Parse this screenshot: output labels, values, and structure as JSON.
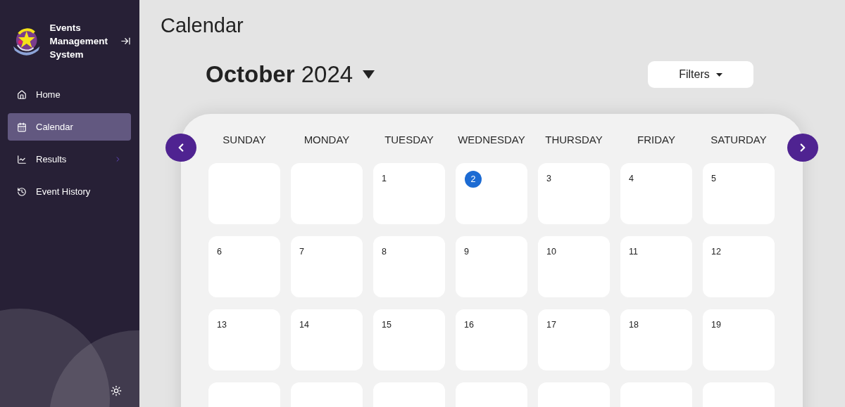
{
  "sidebar": {
    "app_name": "Events Management System",
    "items": [
      {
        "label": "Home",
        "selected": false,
        "has_submenu": false
      },
      {
        "label": "Calendar",
        "selected": true,
        "has_submenu": false
      },
      {
        "label": "Results",
        "selected": false,
        "has_submenu": true
      },
      {
        "label": "Event History",
        "selected": false,
        "has_submenu": false
      }
    ]
  },
  "page_title": "Calendar",
  "month_picker": {
    "label": "**October** 2024"
  },
  "filters_button": {
    "label": "Filters"
  },
  "calendar": {
    "weekdays": [
      "SUNDAY",
      "MONDAY",
      "TUESDAY",
      "WEDNESDAY",
      "THURSDAY",
      "FRIDAY",
      "SATURDAY"
    ],
    "weeks": [
      [
        {
          "kind": "blank"
        },
        {
          "kind": "blank"
        },
        {
          "day": "1",
          "today": false
        },
        {
          "day": "2",
          "today": true
        },
        {
          "day": "3",
          "today": false
        },
        {
          "day": "4",
          "today": false
        },
        {
          "day": "5",
          "today": false
        }
      ],
      [
        {
          "day": "6",
          "today": false
        },
        {
          "day": "7",
          "today": false
        },
        {
          "day": "8",
          "today": false
        },
        {
          "day": "9",
          "today": false
        },
        {
          "day": "10",
          "today": false
        },
        {
          "day": "11",
          "today": false
        },
        {
          "day": "12",
          "today": false
        }
      ],
      [
        {
          "day": "13",
          "today": false
        },
        {
          "day": "14",
          "today": false
        },
        {
          "day": "15",
          "today": false
        },
        {
          "day": "16",
          "today": false
        },
        {
          "day": "17",
          "today": false
        },
        {
          "day": "18",
          "today": false
        },
        {
          "day": "19",
          "today": false
        }
      ],
      [
        {
          "kind": "blank"
        },
        {
          "kind": "blank"
        },
        {
          "kind": "blank"
        },
        {
          "kind": "blank"
        },
        {
          "kind": "blank"
        },
        {
          "kind": "blank"
        },
        {
          "kind": "blank"
        }
      ]
    ]
  }
}
